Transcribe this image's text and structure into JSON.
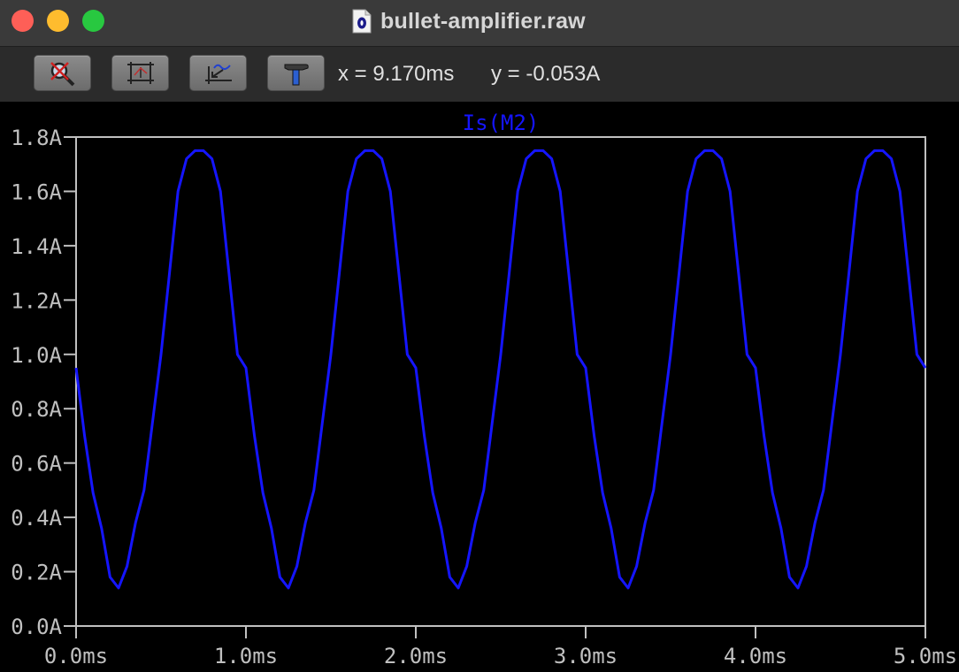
{
  "window": {
    "title": "bullet-amplifier.raw"
  },
  "toolbar": {
    "buttons": [
      {
        "icon": "zoom-cancel-icon"
      },
      {
        "icon": "autorange-icon"
      },
      {
        "icon": "zoom-back-icon"
      },
      {
        "icon": "hammer-icon"
      }
    ],
    "readout_x": "x = 9.170ms",
    "readout_y": "y = -0.053A"
  },
  "colors": {
    "trace": "#1515ff",
    "axes": "#c0c0c0",
    "background": "#000000"
  },
  "chart_data": {
    "type": "line",
    "title": "Is(M2)",
    "xlabel": "",
    "ylabel": "",
    "xlim": [
      0,
      5
    ],
    "ylim": [
      0,
      1.8
    ],
    "x_unit": "ms",
    "y_unit": "A",
    "xticks": [
      "0.0ms",
      "1.0ms",
      "2.0ms",
      "3.0ms",
      "4.0ms",
      "5.0ms"
    ],
    "yticks": [
      "0.0A",
      "0.2A",
      "0.4A",
      "0.6A",
      "0.8A",
      "1.0A",
      "1.2A",
      "1.4A",
      "1.6A",
      "1.8A"
    ],
    "series": [
      {
        "name": "Is(M2)",
        "x": [
          0.0,
          0.05,
          0.1,
          0.15,
          0.2,
          0.25,
          0.3,
          0.35,
          0.4,
          0.45,
          0.5,
          0.55,
          0.6,
          0.65,
          0.7,
          0.75,
          0.8,
          0.85,
          0.9,
          0.95,
          1.0,
          1.05,
          1.1,
          1.15,
          1.2,
          1.25,
          1.3,
          1.35,
          1.4,
          1.45,
          1.5,
          1.55,
          1.6,
          1.65,
          1.7,
          1.75,
          1.8,
          1.85,
          1.9,
          1.95,
          2.0,
          2.05,
          2.1,
          2.15,
          2.2,
          2.25,
          2.3,
          2.35,
          2.4,
          2.45,
          2.5,
          2.55,
          2.6,
          2.65,
          2.7,
          2.75,
          2.8,
          2.85,
          2.9,
          2.95,
          3.0,
          3.05,
          3.1,
          3.15,
          3.2,
          3.25,
          3.3,
          3.35,
          3.4,
          3.45,
          3.5,
          3.55,
          3.6,
          3.65,
          3.7,
          3.75,
          3.8,
          3.85,
          3.9,
          3.95,
          4.0,
          4.05,
          4.1,
          4.15,
          4.2,
          4.25,
          4.3,
          4.35,
          4.4,
          4.45,
          4.5,
          4.55,
          4.6,
          4.65,
          4.7,
          4.75,
          4.8,
          4.85,
          4.9,
          4.95,
          5.0
        ],
        "y": [
          0.95,
          0.7,
          0.49,
          0.36,
          0.18,
          0.14,
          0.22,
          0.38,
          0.5,
          0.75,
          1.0,
          1.3,
          1.6,
          1.72,
          1.75,
          1.75,
          1.72,
          1.6,
          1.3,
          1.0,
          0.95,
          0.7,
          0.49,
          0.36,
          0.18,
          0.14,
          0.22,
          0.38,
          0.5,
          0.75,
          1.0,
          1.3,
          1.6,
          1.72,
          1.75,
          1.75,
          1.72,
          1.6,
          1.3,
          1.0,
          0.95,
          0.7,
          0.49,
          0.36,
          0.18,
          0.14,
          0.22,
          0.38,
          0.5,
          0.75,
          1.0,
          1.3,
          1.6,
          1.72,
          1.75,
          1.75,
          1.72,
          1.6,
          1.3,
          1.0,
          0.95,
          0.7,
          0.49,
          0.36,
          0.18,
          0.14,
          0.22,
          0.38,
          0.5,
          0.75,
          1.0,
          1.3,
          1.6,
          1.72,
          1.75,
          1.75,
          1.72,
          1.6,
          1.3,
          1.0,
          0.95,
          0.7,
          0.49,
          0.36,
          0.18,
          0.14,
          0.22,
          0.38,
          0.5,
          0.75,
          1.0,
          1.3,
          1.6,
          1.72,
          1.75,
          1.75,
          1.72,
          1.6,
          1.3,
          1.0,
          0.95
        ]
      }
    ],
    "grid": false,
    "legend": "none"
  }
}
